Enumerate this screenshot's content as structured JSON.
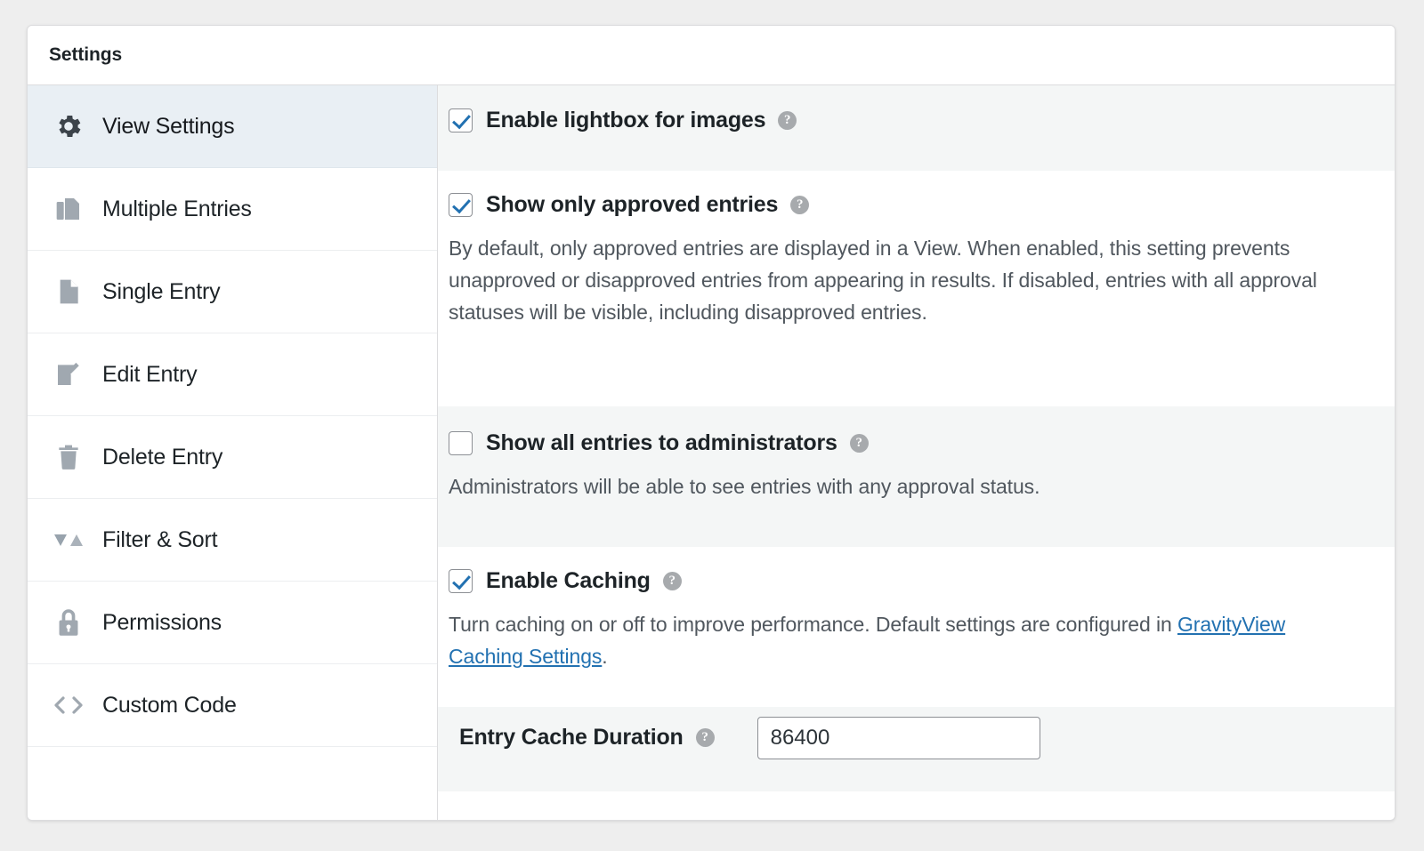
{
  "panel": {
    "title": "Settings"
  },
  "sidebar": {
    "items": [
      {
        "label": "View Settings",
        "icon": "gear-icon",
        "active": true
      },
      {
        "label": "Multiple Entries",
        "icon": "copy-pages-icon",
        "active": false
      },
      {
        "label": "Single Entry",
        "icon": "document-icon",
        "active": false
      },
      {
        "label": "Edit Entry",
        "icon": "pencil-edit-icon",
        "active": false
      },
      {
        "label": "Delete Entry",
        "icon": "trash-icon",
        "active": false
      },
      {
        "label": "Filter & Sort",
        "icon": "sort-arrows-icon",
        "active": false
      },
      {
        "label": "Permissions",
        "icon": "lock-icon",
        "active": false
      },
      {
        "label": "Custom Code",
        "icon": "code-brackets-icon",
        "active": false
      }
    ]
  },
  "settings": {
    "lightbox": {
      "label": "Enable lightbox for images",
      "checked": true,
      "help": "?"
    },
    "approved_entries": {
      "label": "Show only approved entries",
      "checked": true,
      "help": "?",
      "description": "By default, only approved entries are displayed in a View. When enabled, this setting prevents unapproved or disapproved entries from appearing in results. If disabled, entries with all approval statuses will be visible, including disapproved entries."
    },
    "admin_entries": {
      "label": "Show all entries to administrators",
      "checked": false,
      "help": "?",
      "description": "Administrators will be able to see entries with any approval status."
    },
    "caching": {
      "label": "Enable Caching",
      "checked": true,
      "help": "?",
      "description_before": "Turn caching on or off to improve performance. Default settings are configured in ",
      "link_text": "GravityView Caching Settings",
      "description_after": "."
    },
    "cache_duration": {
      "label": "Entry Cache Duration",
      "help": "?",
      "value": "86400",
      "placeholder": ""
    }
  },
  "colors": {
    "accent": "#2271b1",
    "active_nav_bg": "#e9eff4",
    "shaded_row_bg": "#f4f6f6",
    "text": "#1d2327",
    "muted_text": "#50575e"
  }
}
